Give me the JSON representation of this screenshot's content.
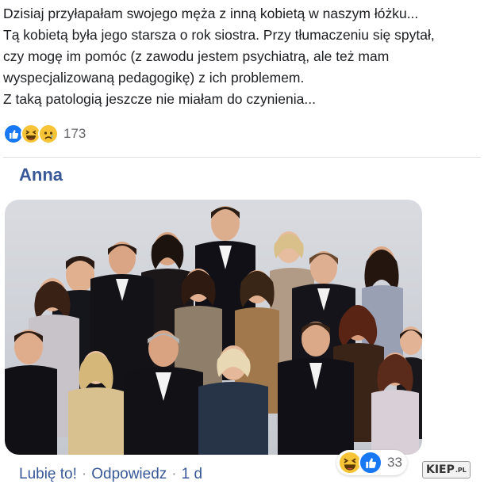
{
  "post": {
    "lines": [
      "Dzisiaj przyłapałam swojego męża z inną kobietą w naszym łóżku...",
      "Tą kobietą była jego starsza o rok siostra. Przy tłumaczeniu się spytał,",
      "czy mogę im pomóc (z zawodu jestem psychiatrą, ale też mam",
      "wyspecjalizowaną pedagogikę) z ich problemem.",
      "Z taką patologią jeszcze nie miałam do czynienia..."
    ],
    "reactions": [
      "like-icon",
      "haha-icon",
      "sad-icon"
    ],
    "reaction_count": "173"
  },
  "comment": {
    "author": "Anna",
    "photo": "group-portrait-photo",
    "actions": {
      "like": "Lubię to!",
      "separator": "·",
      "reply": "Odpowiedz",
      "time": "1 d"
    },
    "reactions": [
      "haha-icon",
      "like-icon"
    ],
    "reaction_count": "33"
  },
  "watermark": {
    "text": "KIEP",
    "suffix": ".PL"
  },
  "colors": {
    "text": "#1c1e21",
    "link": "#385898",
    "muted": "#65676b",
    "like_blue": "#1877f2",
    "emoji_yellow": "#f7c438"
  }
}
